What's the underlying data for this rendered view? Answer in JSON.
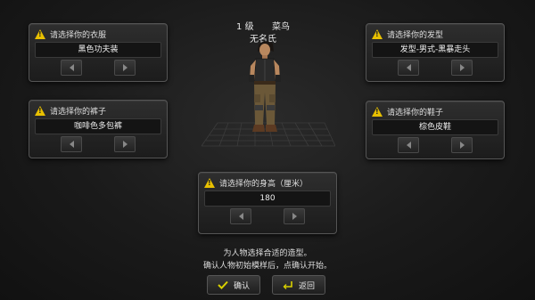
{
  "panels": {
    "top_clothes": {
      "title": "请选择你的衣服",
      "value": "黑色功夫装"
    },
    "pants": {
      "title": "请选择你的裤子",
      "value": "咖啡色多包裤"
    },
    "hair": {
      "title": "请选择你的发型",
      "value": "发型-男式-黑暴走头"
    },
    "shoes": {
      "title": "请选择你的鞋子",
      "value": "棕色皮鞋"
    },
    "height": {
      "title": "请选择你的身高（厘米）",
      "value": "180"
    }
  },
  "character": {
    "level": "1 级",
    "rank": "菜鸟",
    "name": "无名氏"
  },
  "hint": {
    "line1": "为人物选择合适的造型。",
    "line2": "确认人物初始模样后，点确认开始。"
  },
  "buttons": {
    "confirm": "确认",
    "back": "返回"
  },
  "colors": {
    "warning": "#e8c000",
    "confirm_check": "#d8d000",
    "back_icon": "#d8d000"
  }
}
